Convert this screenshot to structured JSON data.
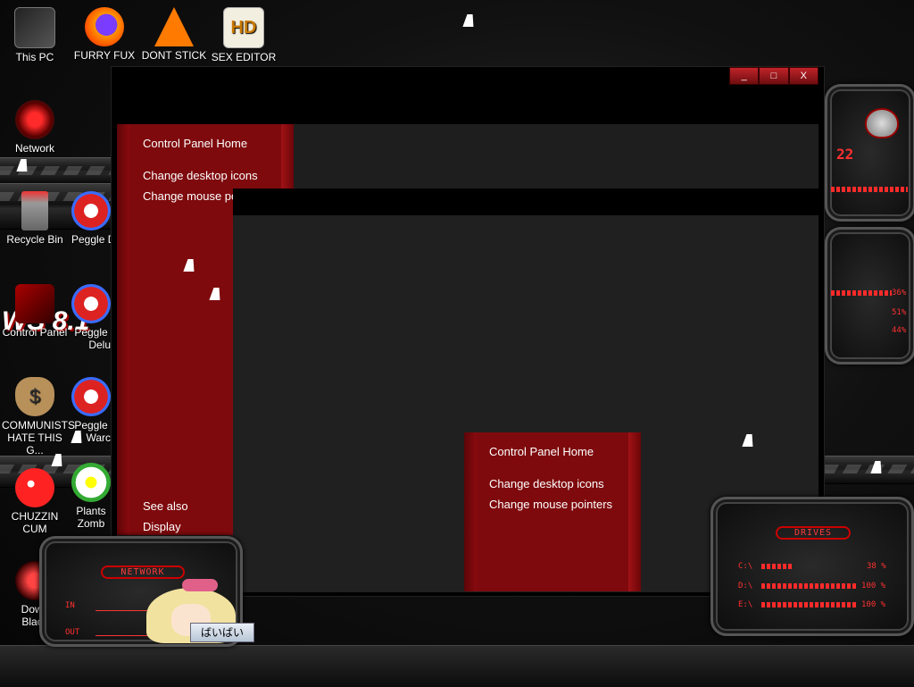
{
  "desktop": {
    "icons": [
      {
        "label": "This PC",
        "icon": "computer-icon"
      },
      {
        "label": "FURRY FUX",
        "icon": "firefox-icon"
      },
      {
        "label": "DONT STICK",
        "icon": "vlc-icon"
      },
      {
        "label": "SEX EDITOR",
        "icon": "hxd-icon"
      },
      {
        "label": "Network",
        "icon": "network-icon"
      },
      {
        "label": "Recycle Bin",
        "icon": "recycle-bin-icon"
      },
      {
        "label": "Peggle D",
        "icon": "peggle-icon"
      },
      {
        "label": "Control Panel",
        "icon": "control-panel-icon"
      },
      {
        "label": "Peggle",
        "icon": "peggle-icon"
      },
      {
        "label": "Delu",
        "icon": ""
      },
      {
        "label": "COMMUNISTS HATE THIS G...",
        "icon": "money-bag-icon"
      },
      {
        "label": "Peggle",
        "icon": "peggle-icon"
      },
      {
        "label": "Warc",
        "icon": ""
      },
      {
        "label": "CHUZZIN CUM",
        "icon": "chuzzle-icon"
      },
      {
        "label": "Plants",
        "icon": "flower-icon"
      },
      {
        "label": "Zomb",
        "icon": ""
      },
      {
        "label": "Down",
        "icon": "alienware-icon"
      },
      {
        "label": "Black",
        "icon": ""
      }
    ],
    "wallpaper_text": "WS 8.1"
  },
  "window": {
    "buttons": {
      "minimize": "_",
      "maximize": "□",
      "close": "X"
    },
    "side_panel": {
      "home": "Control Panel Home",
      "links": [
        "Change desktop icons",
        "Change mouse poi"
      ],
      "see_also": "See also",
      "see_also_links": [
        "Display"
      ]
    }
  },
  "popup_panel": {
    "home": "Control Panel Home",
    "links": [
      "Change desktop icons",
      "Change mouse pointers"
    ]
  },
  "gadgets": {
    "network": {
      "title": "NETWORK",
      "in_label": "IN",
      "out_label": "OUT"
    },
    "drives": {
      "title": "DRIVES",
      "rows": [
        {
          "label": "C:\\",
          "value": "38 %"
        },
        {
          "label": "D:\\",
          "value": "100 %"
        },
        {
          "label": "E:\\",
          "value": "100 %"
        }
      ]
    },
    "system": {
      "values": [
        "36%",
        "51%",
        "44%"
      ],
      "number": "22"
    }
  },
  "chat_bubble": {
    "text": "ばいばい"
  },
  "colors": {
    "accent_red": "#8a0a0e",
    "gadget_red": "#ff3030"
  }
}
